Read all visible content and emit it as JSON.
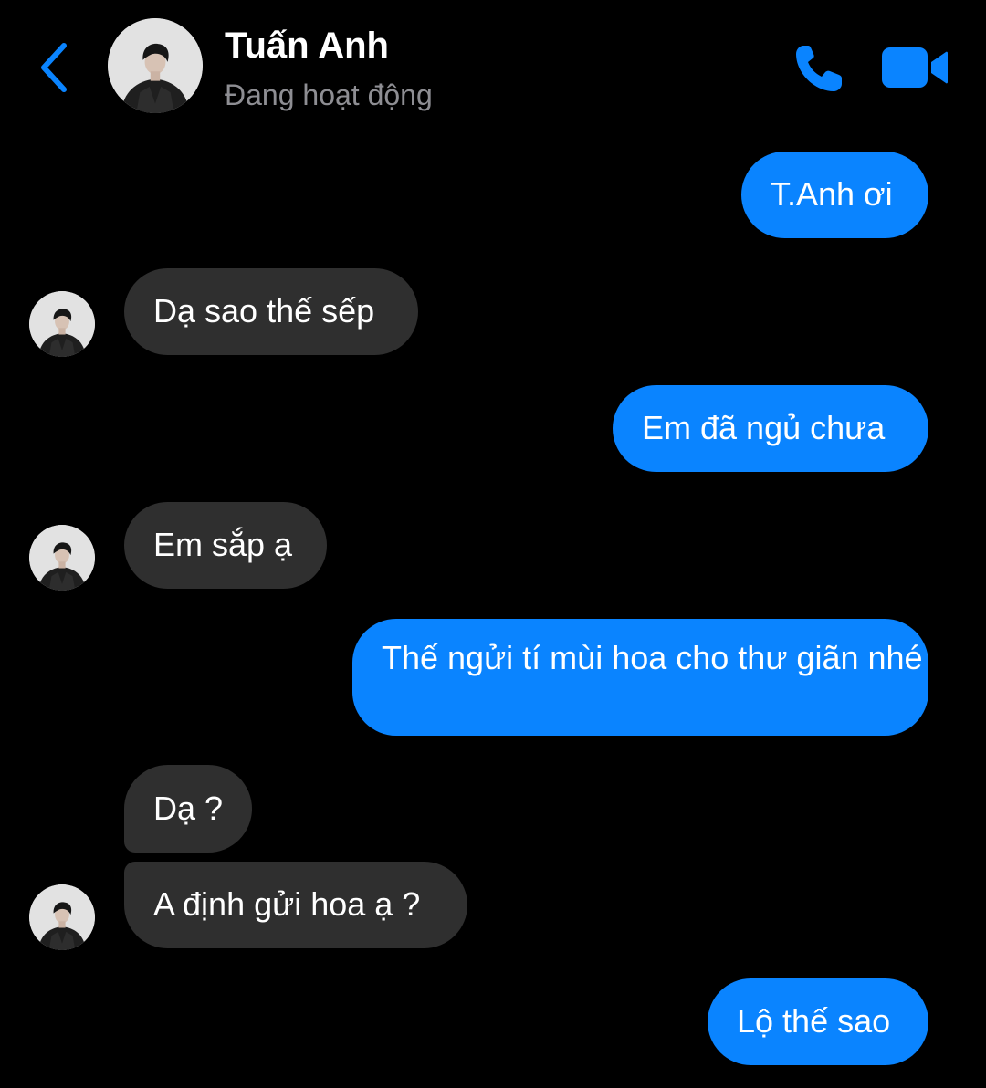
{
  "header": {
    "contact_name": "Tuấn Anh",
    "status": "Đang hoạt động",
    "back_icon": "chevron-left-icon",
    "call_icon": "phone-icon",
    "video_icon": "video-camera-icon"
  },
  "colors": {
    "background": "#000000",
    "accent": "#0a84ff",
    "outgoing_bubble": "#0a84ff",
    "incoming_bubble": "#2f2f2f",
    "status_text": "#8e8e93"
  },
  "messages": [
    {
      "direction": "outgoing",
      "text": "T.Anh ơi"
    },
    {
      "direction": "incoming",
      "text": "Dạ sao thế sếp"
    },
    {
      "direction": "outgoing",
      "text": "Em đã ngủ chưa"
    },
    {
      "direction": "incoming",
      "text": "Em sắp ạ"
    },
    {
      "direction": "outgoing",
      "text": "Thế ngửi tí mùi hoa cho thư giãn nhé"
    },
    {
      "direction": "incoming",
      "text": "Dạ ?"
    },
    {
      "direction": "incoming",
      "text": "A định gửi hoa ạ ?"
    },
    {
      "direction": "outgoing",
      "text": "Lộ thế sao"
    }
  ]
}
